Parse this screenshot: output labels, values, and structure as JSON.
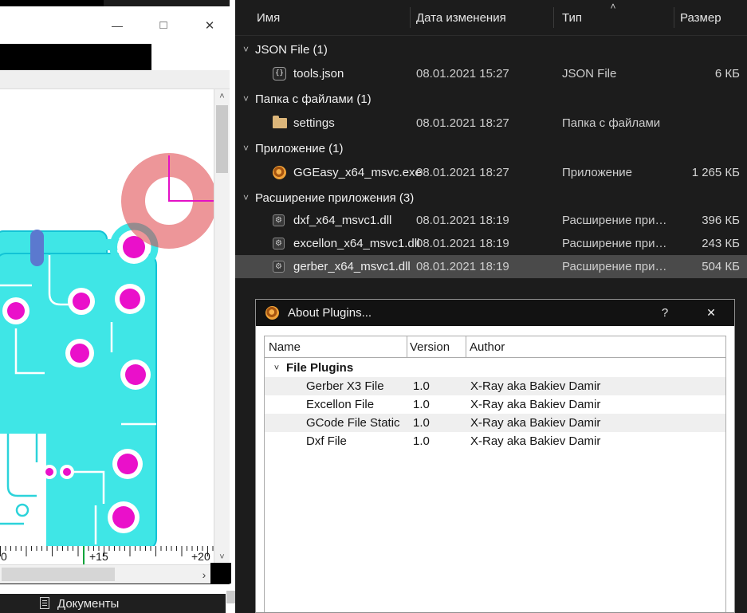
{
  "icons": {
    "minimize": "—",
    "maximize": "□",
    "close": "✕",
    "chevron_down": "˅",
    "sort_asc": "˄",
    "scroll_up": "˄",
    "scroll_down": "˅",
    "scroll_right": "›",
    "help": "?",
    "dialog_close": "✕",
    "json_braces": "{}",
    "gear": "⚙"
  },
  "pcb_window": {
    "ruler_labels": [
      "0",
      "+15",
      "+20"
    ],
    "dock_title": "Документы"
  },
  "explorer": {
    "columns": [
      "Имя",
      "Дата изменения",
      "Тип",
      "Размер"
    ],
    "sort_column": "Тип",
    "groups": [
      {
        "label": "JSON File (1)",
        "items": [
          {
            "name": "tools.json",
            "date": "08.01.2021 15:27",
            "type": "JSON File",
            "size": "6 КБ"
          }
        ]
      },
      {
        "label": "Папка с файлами (1)",
        "items": [
          {
            "name": "settings",
            "date": "08.01.2021 18:27",
            "type": "Папка с файлами",
            "size": ""
          }
        ]
      },
      {
        "label": "Приложение (1)",
        "items": [
          {
            "name": "GGEasy_x64_msvc.exe",
            "date": "08.01.2021 18:27",
            "type": "Приложение",
            "size": "1 265 КБ"
          }
        ]
      },
      {
        "label": "Расширение приложения (3)",
        "items": [
          {
            "name": "dxf_x64_msvc1.dll",
            "date": "08.01.2021 18:19",
            "type": "Расширение при…",
            "size": "396 КБ"
          },
          {
            "name": "excellon_x64_msvc1.dll",
            "date": "08.01.2021 18:19",
            "type": "Расширение при…",
            "size": "243 КБ"
          },
          {
            "name": "gerber_x64_msvc1.dll",
            "date": "08.01.2021 18:19",
            "type": "Расширение при…",
            "size": "504 КБ",
            "selected": true
          }
        ]
      }
    ]
  },
  "dialog": {
    "title": "About Plugins...",
    "table": {
      "columns": [
        "Name",
        "Version",
        "Author"
      ],
      "group_label": "File Plugins",
      "rows": [
        {
          "name": "Gerber X3 File",
          "version": "1.0",
          "author": "X-Ray aka Bakiev Damir"
        },
        {
          "name": "Excellon File",
          "version": "1.0",
          "author": "X-Ray aka Bakiev Damir"
        },
        {
          "name": "GCode File Static",
          "version": "1.0",
          "author": "X-Ray aka Bakiev Damir"
        },
        {
          "name": "Dxf File",
          "version": "1.0",
          "author": "X-Ray aka Bakiev Damir"
        }
      ]
    }
  },
  "colors": {
    "copper": "#3fe6e6",
    "pad": "#ea10ca",
    "highlight_ring": "#dc4046",
    "explorer_bg": "#1c1c1c",
    "selection": "#4a4a4a",
    "folder": "#dcb67a"
  }
}
